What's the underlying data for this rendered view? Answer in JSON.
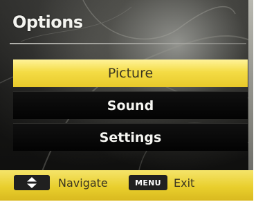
{
  "header": {
    "title": "Options"
  },
  "menu": {
    "items": [
      {
        "label": "Picture",
        "selected": true
      },
      {
        "label": "Sound",
        "selected": false
      },
      {
        "label": "Settings",
        "selected": false
      }
    ]
  },
  "footer": {
    "navigate_icon": "up-down-arrows-icon",
    "navigate_label": "Navigate",
    "menu_key_label": "MENU",
    "exit_label": "Exit"
  },
  "colors": {
    "highlight": "#f4dc45",
    "footer_bar": "#e9cf2d",
    "menu_bar": "#050505",
    "text": "#f6f6f2"
  }
}
